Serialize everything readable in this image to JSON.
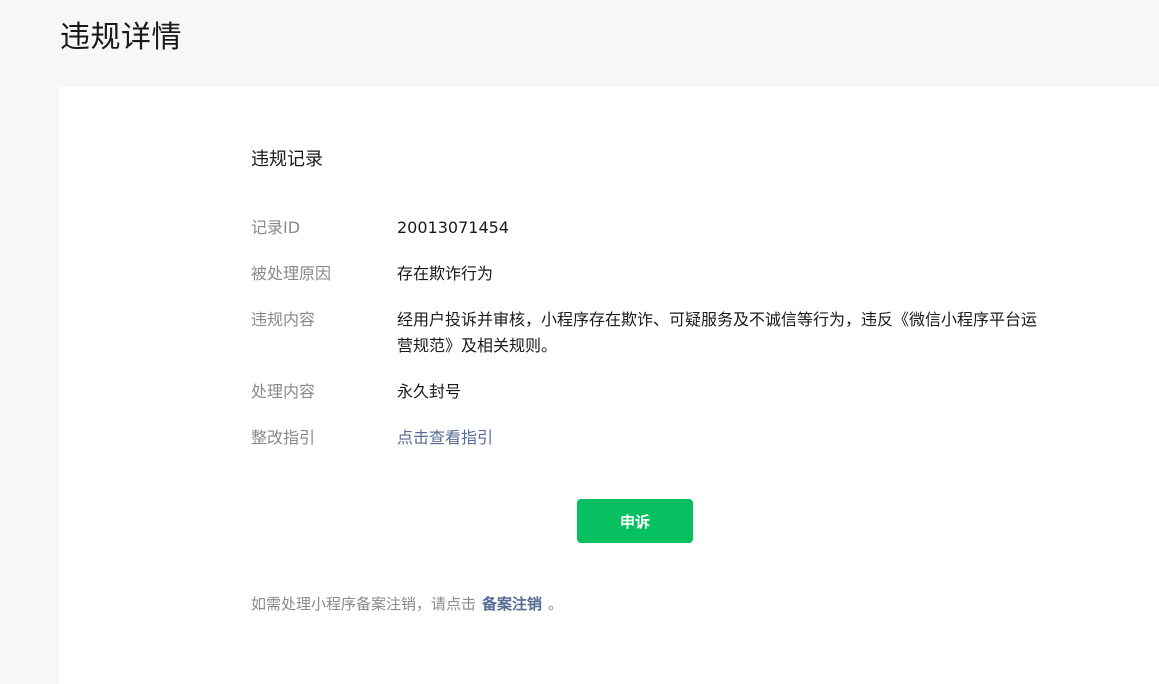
{
  "page": {
    "title": "违规详情"
  },
  "record": {
    "section_title": "违规记录",
    "rows": [
      {
        "label": "记录ID",
        "value": "20013071454"
      },
      {
        "label": "被处理原因",
        "value": "存在欺诈行为"
      },
      {
        "label": "违规内容",
        "value": "经用户投诉并审核，小程序存在欺诈、可疑服务及不诚信等行为，违反《微信小程序平台运营规范》及相关规则。"
      },
      {
        "label": "处理内容",
        "value": "永久封号"
      },
      {
        "label": "整改指引",
        "value": "点击查看指引"
      }
    ]
  },
  "actions": {
    "appeal_label": "申诉"
  },
  "footer": {
    "prefix": "如需处理小程序备案注销，请点击",
    "link_label": "备案注销",
    "suffix": "。"
  },
  "colors": {
    "accent_green": "#07c160",
    "link_blue": "#576b95",
    "label_gray": "#8a8a8a",
    "page_bg": "#f6f7f9"
  }
}
